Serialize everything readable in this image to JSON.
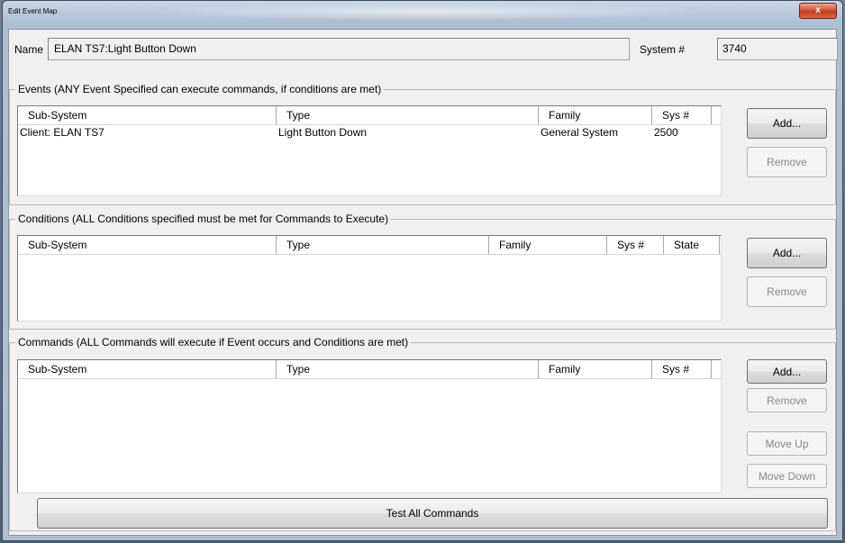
{
  "window": {
    "title": "Edit Event Map",
    "close_glyph": "x"
  },
  "name_field": {
    "label": "Name",
    "value": "ELAN TS7:Light Button Down"
  },
  "system_field": {
    "label": "System #",
    "value": "3740"
  },
  "events": {
    "title": "Events (ANY Event Specified can execute commands, if conditions are met)",
    "columns": [
      "Sub-System",
      "Type",
      "Family",
      "Sys #"
    ],
    "rows": [
      [
        "Client: ELAN TS7",
        "Light Button Down",
        "General System",
        "2500"
      ]
    ],
    "add_label": "Add...",
    "remove_label": "Remove"
  },
  "conditions": {
    "title": "Conditions (ALL Conditions specified must be met for Commands to Execute)",
    "columns": [
      "Sub-System",
      "Type",
      "Family",
      "Sys #",
      "State"
    ],
    "rows": [],
    "add_label": "Add...",
    "remove_label": "Remove"
  },
  "commands": {
    "title": "Commands (ALL Commands will execute if Event occurs and Conditions are met)",
    "columns": [
      "Sub-System",
      "Type",
      "Family",
      "Sys #"
    ],
    "rows": [],
    "add_label": "Add...",
    "remove_label": "Remove",
    "move_up_label": "Move Up",
    "move_down_label": "Move Down",
    "test_all_label": "Test All Commands"
  }
}
